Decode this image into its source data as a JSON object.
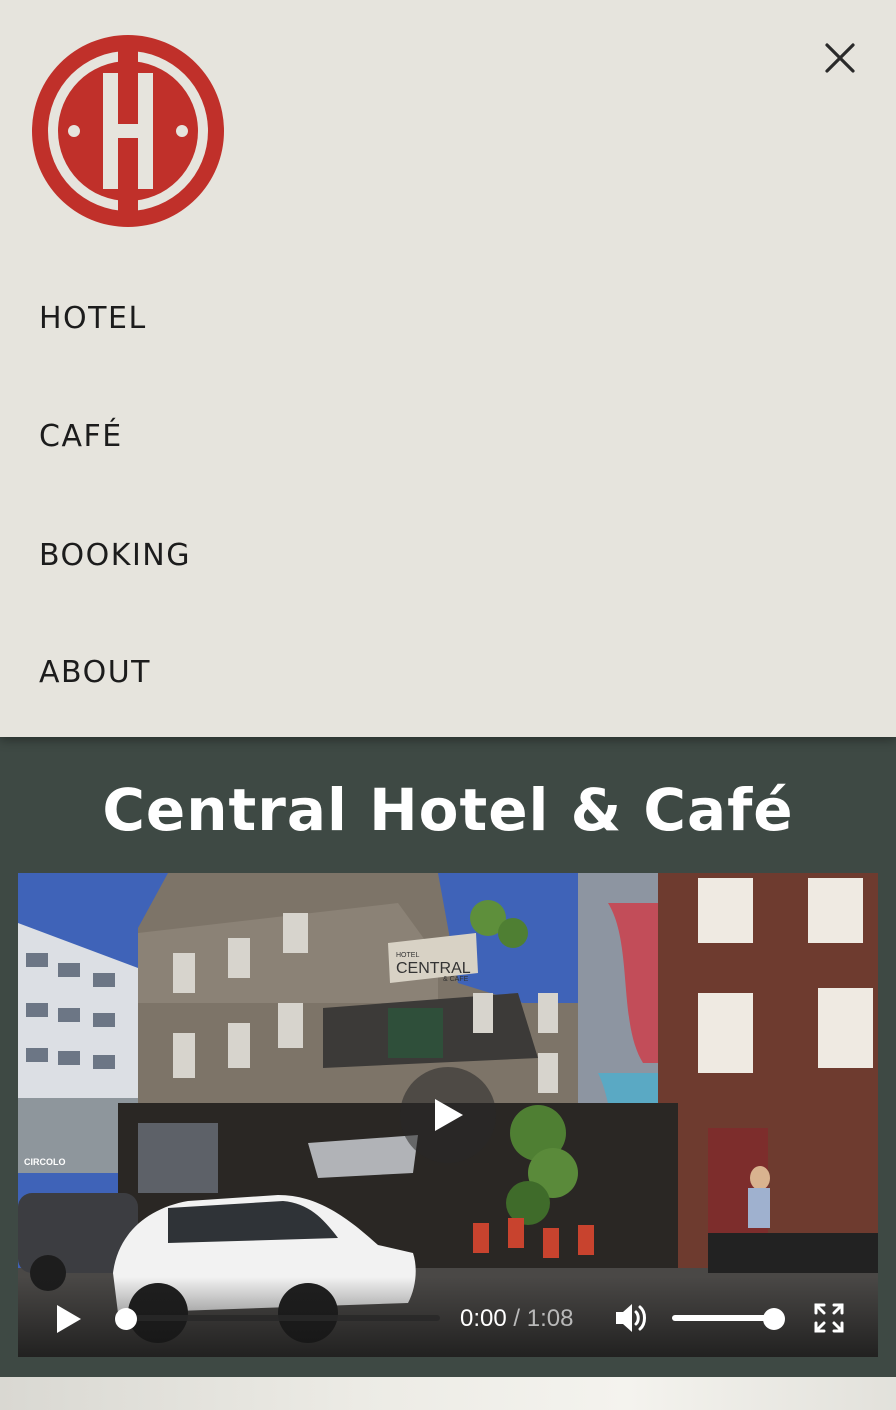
{
  "brand": {
    "logo_letter": "H",
    "logo_color": "#c0302a",
    "background": "#e6e4dd"
  },
  "menu": {
    "close_label": "×",
    "items": [
      {
        "label": "HOTEL"
      },
      {
        "label": "CAFÉ"
      },
      {
        "label": "BOOKING"
      },
      {
        "label": "ABOUT"
      }
    ]
  },
  "hero": {
    "title": "Central Hotel & Café",
    "background": "#3e4944"
  },
  "video": {
    "sign_top": "HOTEL",
    "sign_main": "CENTRAL",
    "sign_bottom": "& CAFE",
    "shop_sign": "CIRCOLO",
    "current_time": "0:00",
    "separator": "/",
    "duration": "1:08",
    "progress": 0,
    "volume": 1,
    "icons": {
      "big_play": "play-icon",
      "play": "play-icon",
      "volume": "volume-icon",
      "fullscreen": "fullscreen-icon"
    }
  }
}
